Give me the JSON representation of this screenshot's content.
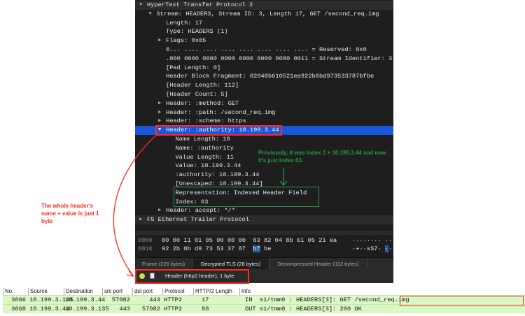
{
  "tree": [
    {
      "level": 0,
      "tri": "down",
      "text": "HyperText Transfer Protocol 2",
      "top": true
    },
    {
      "level": 1,
      "tri": "down",
      "text": "Stream: HEADERS, Stream ID: 3, Length 17, GET /second_req.img"
    },
    {
      "level": 2,
      "tri": "",
      "text": "Length: 17"
    },
    {
      "level": 2,
      "tri": "",
      "text": "Type: HEADERS (1)"
    },
    {
      "level": 2,
      "tri": "right",
      "text": "Flags: 0x05"
    },
    {
      "level": 2,
      "tri": "",
      "text": "0... .... .... .... .... .... .... .... = Reserved: 0x0"
    },
    {
      "level": 2,
      "tri": "",
      "text": ".000 0000 0000 0000 0000 0000 0000 0011 = Stream Identifier: 3"
    },
    {
      "level": 2,
      "tri": "",
      "text": "[Pad Length: 0]"
    },
    {
      "level": 2,
      "tri": "",
      "text": "Header Block Fragment: 82048b610521ea922b0bd973533787bfbe"
    },
    {
      "level": 2,
      "tri": "",
      "text": "[Header Length: 112]"
    },
    {
      "level": 2,
      "tri": "",
      "text": "[Header Count: 5]"
    },
    {
      "level": 2,
      "tri": "right",
      "text": "Header: :method: GET"
    },
    {
      "level": 2,
      "tri": "right",
      "text": "Header: :path: /second_req.img"
    },
    {
      "level": 2,
      "tri": "right",
      "text": "Header: :scheme: https"
    },
    {
      "level": 2,
      "tri": "down",
      "text": "Header: :authority: 10.199.3.44",
      "selected": true
    },
    {
      "level": 3,
      "tri": "",
      "text": "Name Length: 10"
    },
    {
      "level": 3,
      "tri": "",
      "text": "Name: :authority"
    },
    {
      "level": 3,
      "tri": "",
      "text": "Value Length: 11"
    },
    {
      "level": 3,
      "tri": "",
      "text": "Value: 10.199.3.44"
    },
    {
      "level": 3,
      "tri": "",
      "text": ":authority: 10.199.3.44"
    },
    {
      "level": 3,
      "tri": "",
      "text": "[Unescaped: 10.199.3.44]"
    },
    {
      "level": 3,
      "tri": "",
      "text": "Representation: Indexed Header Field"
    },
    {
      "level": 3,
      "tri": "",
      "text": "Index: 63"
    },
    {
      "level": 2,
      "tri": "right",
      "text": "Header: accept: */*"
    },
    {
      "level": 0,
      "tri": "right",
      "text": "F5 Ethernet Trailer Protocol",
      "top": true
    }
  ],
  "hex": {
    "offsets": [
      "0000",
      "0010"
    ],
    "line1_bytes": "00 00 11 01 05 00 00 00  03 82 04 8b 61 05 21 ea",
    "line2_bytes_a": "92 2b 0b d9 73 53 37 87",
    "line2_highlight": "bf",
    "line2_bytes_b": "be",
    "line1_ascii": "········ ··",
    "line2_ascii_a": "·+··sS7·",
    "line2_ascii_hl": "·",
    "line2_ascii_b": "·"
  },
  "tabs": [
    "Frame (226 bytes)",
    "Decrypted TLS (26 bytes)",
    "Decompressed Header (112 bytes)"
  ],
  "status": {
    "text": "Header (http2.header), 1 byte"
  },
  "annotations": {
    "left": "The whole header's name + value is just 1 byte",
    "green": "Previously, it was Index 1 + 10.199.3.44 and now it's just Index 63."
  },
  "colors": {
    "red": "#ff2a1a",
    "green": "#1f9a48",
    "selection": "#1a56db",
    "row_green": "#daf7c4"
  },
  "packets": {
    "columns": [
      "No.",
      "Source",
      "Destination",
      "src port",
      "dst port",
      "Protocol",
      "HTTP/2 Length",
      "Info"
    ],
    "rows": [
      [
        "3066",
        "10.199.3.135",
        "10.199.3.44",
        "57082",
        "443",
        "HTTP2",
        "17",
        "IN  s1/tmm0 : HEADERS[3]: GET /second_req.img"
      ],
      [
        "3068",
        "10.199.3.44",
        "10.199.3.135",
        "443",
        "57082",
        "HTTP2",
        "88",
        "OUT s1/tmm0 : HEADERS[3]: 200 OK"
      ]
    ]
  }
}
